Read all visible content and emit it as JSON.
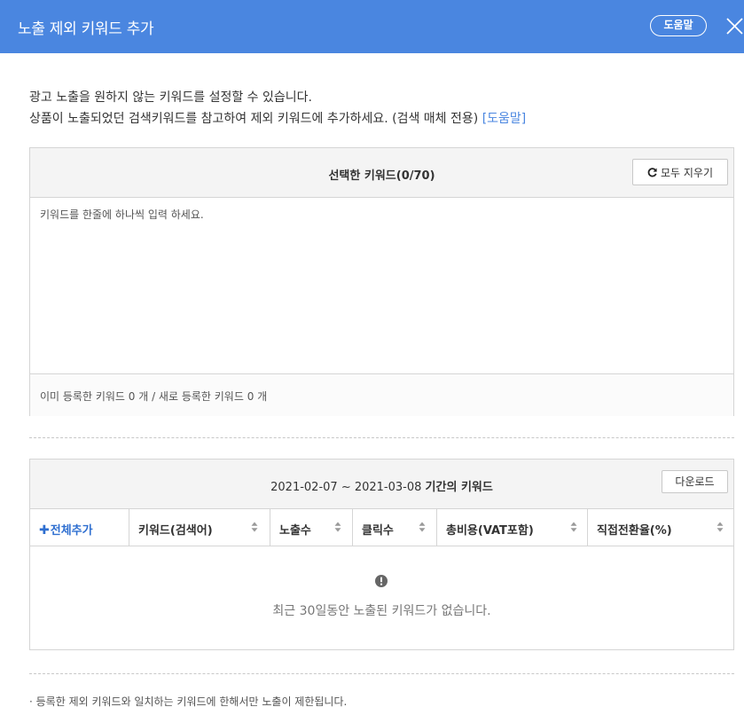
{
  "header": {
    "title": "노출 제외 키워드 추가",
    "help_label": "도움말",
    "bg_color": "#4a86e0"
  },
  "intro": {
    "line1": "광고 노출을 원하지 않는 키워드를 설정할 수 있습니다.",
    "line2": "상품이 노출되었던 검색키워드를 참고하여 제외 키워드에 추가하세요. (검색 매체 전용) ",
    "help_link": "[도움말]"
  },
  "selected": {
    "title": "선택한 키워드(0/70)",
    "clear_label": "모두 지우기",
    "input_value": "",
    "input_placeholder": "키워드를 한줄에 하나씩 입력 하세요.",
    "count_text": "이미 등록한 키워드 0 개 / 새로 등록한 키워드 0 개"
  },
  "period": {
    "title_range": "2021-02-07 ~ 2021-03-08",
    "title_suffix": "기간의 키워드",
    "download_label": "다운로드",
    "add_all_label": "전체추가",
    "columns": [
      "키워드(검색어)",
      "노출수",
      "클릭수",
      "총비용(VAT포함)",
      "직접전환율(%)"
    ],
    "empty_text": "최근 30일동안 노출된 키워드가 없습니다."
  },
  "footer": {
    "note": "· 등록한 제외 키워드와 일치하는 키워드에 한해서만 노출이 제한됩니다."
  }
}
